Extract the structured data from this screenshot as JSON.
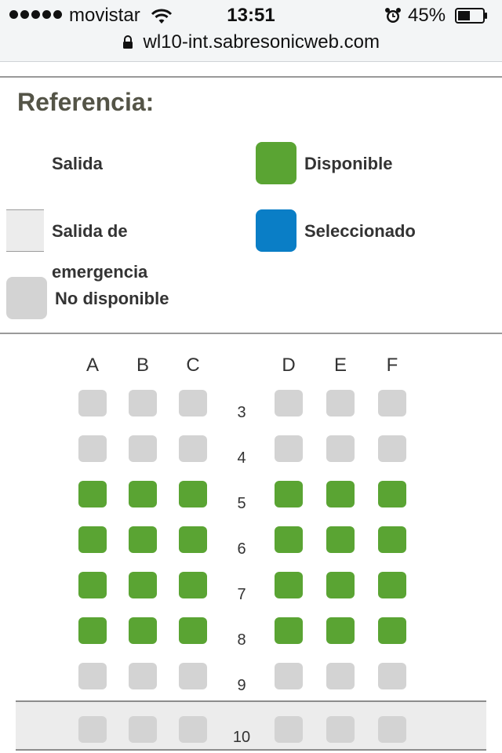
{
  "status_bar": {
    "carrier": "movistar",
    "time": "13:51",
    "battery": "45%"
  },
  "browser": {
    "url": "wl10-int.sabresonicweb.com"
  },
  "legend": {
    "title": "Referencia:",
    "salida": "Salida",
    "salida_emergencia_line1": "Salida de",
    "salida_emergencia_line2": "emergencia",
    "no_disponible": "No disponible",
    "disponible": "Disponible",
    "seleccionado": "Seleccionado"
  },
  "colors": {
    "available": "#5aa433",
    "selected": "#0a7ec6",
    "unavailable": "#d3d3d3",
    "exit_band": "#ececec"
  },
  "seat_map": {
    "columns": [
      "A",
      "B",
      "C",
      "D",
      "E",
      "F"
    ],
    "rows": [
      {
        "number": "3",
        "status": "unavailable"
      },
      {
        "number": "4",
        "status": "unavailable"
      },
      {
        "number": "5",
        "status": "available"
      },
      {
        "number": "6",
        "status": "available"
      },
      {
        "number": "7",
        "status": "available"
      },
      {
        "number": "8",
        "status": "available"
      },
      {
        "number": "9",
        "status": "unavailable"
      },
      {
        "number": "10",
        "status": "unavailable",
        "exit_row": true
      }
    ]
  }
}
